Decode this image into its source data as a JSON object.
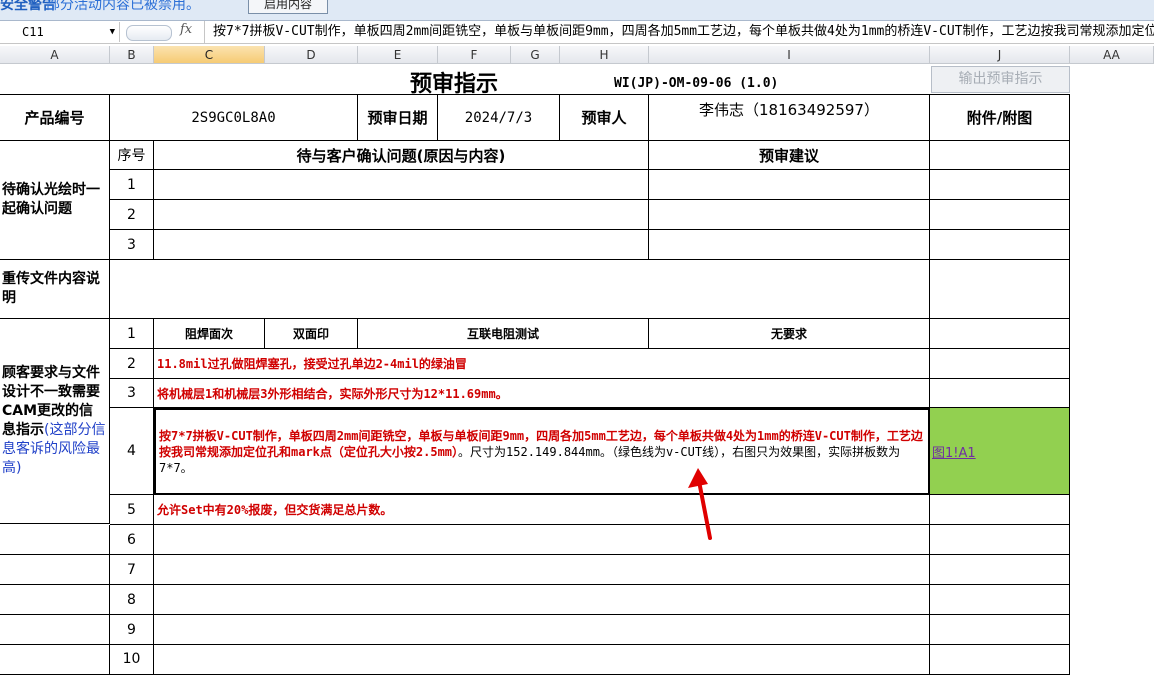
{
  "security_bar": {
    "title": "安全警告",
    "message": "部分活动内容已被禁用。",
    "button": "启用内容"
  },
  "formula_bar": {
    "name_box": "C11",
    "fx": "fx",
    "content": "按7*7拼板V-CUT制作，单板四周2mm间距铣空，单板与单板间距9mm，四周各加5mm工艺边，每个单板共做4处为1mm的桥连V-CUT制作，工艺边按我司常规添加定位孔和mark点"
  },
  "columns": [
    "A",
    "B",
    "C",
    "D",
    "E",
    "F",
    "G",
    "H",
    "I",
    "J",
    "AA"
  ],
  "sheet": {
    "title": "预审指示",
    "doc_code": "WI(JP)-OM-09-06 (1.0)",
    "export_button": "输出预审指示",
    "product_label": "产品编号",
    "product_value": "2S9GC0L8A0",
    "date_label": "预审日期",
    "date_value": "2024/7/3",
    "reviewer_label": "预审人",
    "reviewer_value": "李伟志（18163492597）",
    "attach_label": "附件/附图",
    "seq_label": "序号",
    "question_header": "待与客户确认问题(原因与内容)",
    "suggestion_header": "预审建议",
    "confirm_section": "待确认光绘时一起确认问题",
    "reupload_section": "重传文件内容说明",
    "diff_section_main": "顾客要求与文件设计不一致需要CAM更改的信息指示",
    "diff_section_note": "(这部分信息客诉的风险最高)",
    "confirm_rows": [
      "1",
      "2",
      "3"
    ],
    "row1": {
      "num": "1",
      "c": "阻焊面次",
      "d": "双面印",
      "efgh": "互联电阻测试",
      "i": "无要求"
    },
    "row2": {
      "num": "2",
      "text": "11.8mil过孔做阻焊塞孔，接受过孔单边2-4mil的绿油冒"
    },
    "row3": {
      "num": "3",
      "text": "将机械层1和机械层3外形相结合，实际外形尺寸为12*11.69mm。"
    },
    "row4": {
      "num": "4",
      "text_red": "按7*7拼板V-CUT制作，单板四周2mm间距铣空，单板与单板间距9mm，四周各加5mm工艺边，每个单板共做4处为1mm的桥连V-CUT制作，工艺边按我司常规添加定位孔和mark点（定位孔大小按2.5mm）",
      "text_black": "。尺寸为152.149.844mm。（绿色线为v-CUT线），右图只为效果图，实际拼板数为7*7。",
      "attach_link": "图1!A1"
    },
    "row5": {
      "num": "5",
      "text": "允许Set中有20%报废，但交货满足总片数。"
    },
    "empty_rows": [
      "6",
      "7",
      "8",
      "9",
      "10"
    ]
  },
  "colors": {
    "red_text": "#d00000",
    "attach_fill": "#92d050",
    "link": "#7030a0",
    "arrow": "#e00000"
  }
}
